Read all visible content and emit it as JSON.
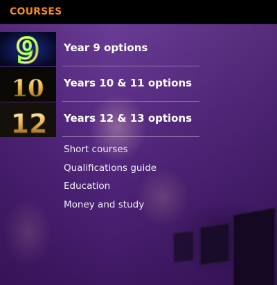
{
  "header": {
    "title": "COURSES"
  },
  "options": [
    {
      "label": "Year 9 options",
      "thumb_number": "9",
      "icon": "number-9-icon"
    },
    {
      "label": "Years 10 & 11 options",
      "thumb_number": "10",
      "icon": "number-10-icon"
    },
    {
      "label": "Years 12 & 13 options",
      "thumb_number": "12",
      "icon": "number-12-icon"
    }
  ],
  "links": [
    "Short courses",
    "Qualifications guide",
    "Education",
    "Money and study"
  ],
  "colors": {
    "accent": "#f28c1a",
    "panel": "#5c2f88",
    "text": "#ffffff"
  }
}
